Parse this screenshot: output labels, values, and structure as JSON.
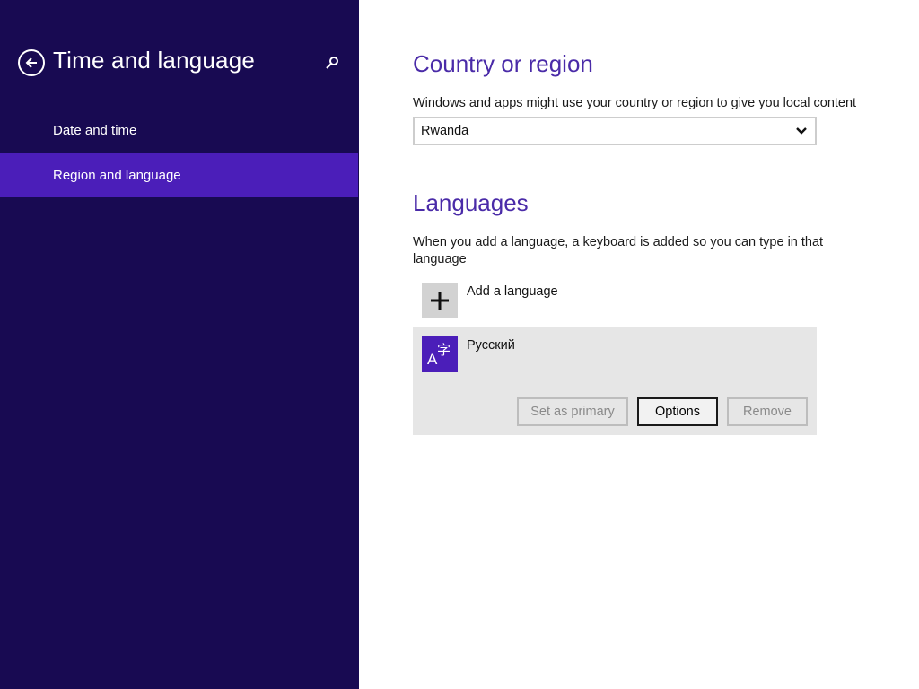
{
  "sidebar": {
    "title": "Time and language",
    "back_icon": "back-arrow-icon",
    "search_icon": "search-icon",
    "items": [
      {
        "label": "Date and time",
        "selected": false
      },
      {
        "label": "Region and language",
        "selected": true
      }
    ]
  },
  "country": {
    "heading": "Country or region",
    "description": "Windows and apps might use your country or region to give you local content",
    "selected_value": "Rwanda"
  },
  "languages": {
    "heading": "Languages",
    "description": "When you add a language, a keyboard is added so you can type in that language",
    "add_label": "Add a language",
    "items": [
      {
        "name": "Русский",
        "tile_glyph_a": "A",
        "tile_glyph_z": "字",
        "buttons": {
          "set_primary": "Set as primary",
          "options": "Options",
          "remove": "Remove"
        }
      }
    ]
  },
  "colors": {
    "sidebar_bg": "#180a52",
    "accent": "#4b1eb9",
    "heading": "#4a2ba8"
  }
}
